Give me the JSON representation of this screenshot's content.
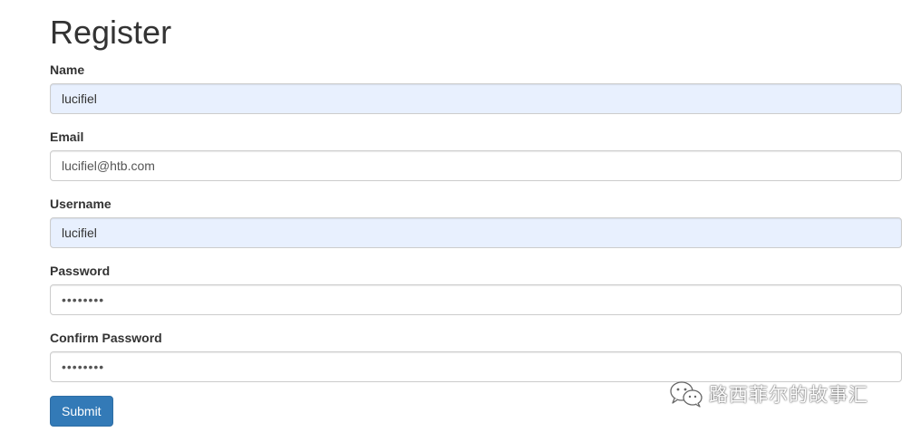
{
  "page": {
    "title": "Register"
  },
  "form": {
    "name": {
      "label": "Name",
      "value": "lucifiel"
    },
    "email": {
      "label": "Email",
      "value": "lucifiel@htb.com"
    },
    "username": {
      "label": "Username",
      "value": "lucifiel"
    },
    "password": {
      "label": "Password",
      "value": "••••••••"
    },
    "confirm_password": {
      "label": "Confirm Password",
      "value": "••••••••"
    },
    "submit_label": "Submit"
  },
  "watermark": {
    "text": "路西菲尔的故事汇",
    "icon": "wechat-icon"
  },
  "colors": {
    "primary_button": "#337ab7",
    "autofill_background": "#e8f0fe",
    "input_border": "#cccccc",
    "text": "#333333"
  }
}
